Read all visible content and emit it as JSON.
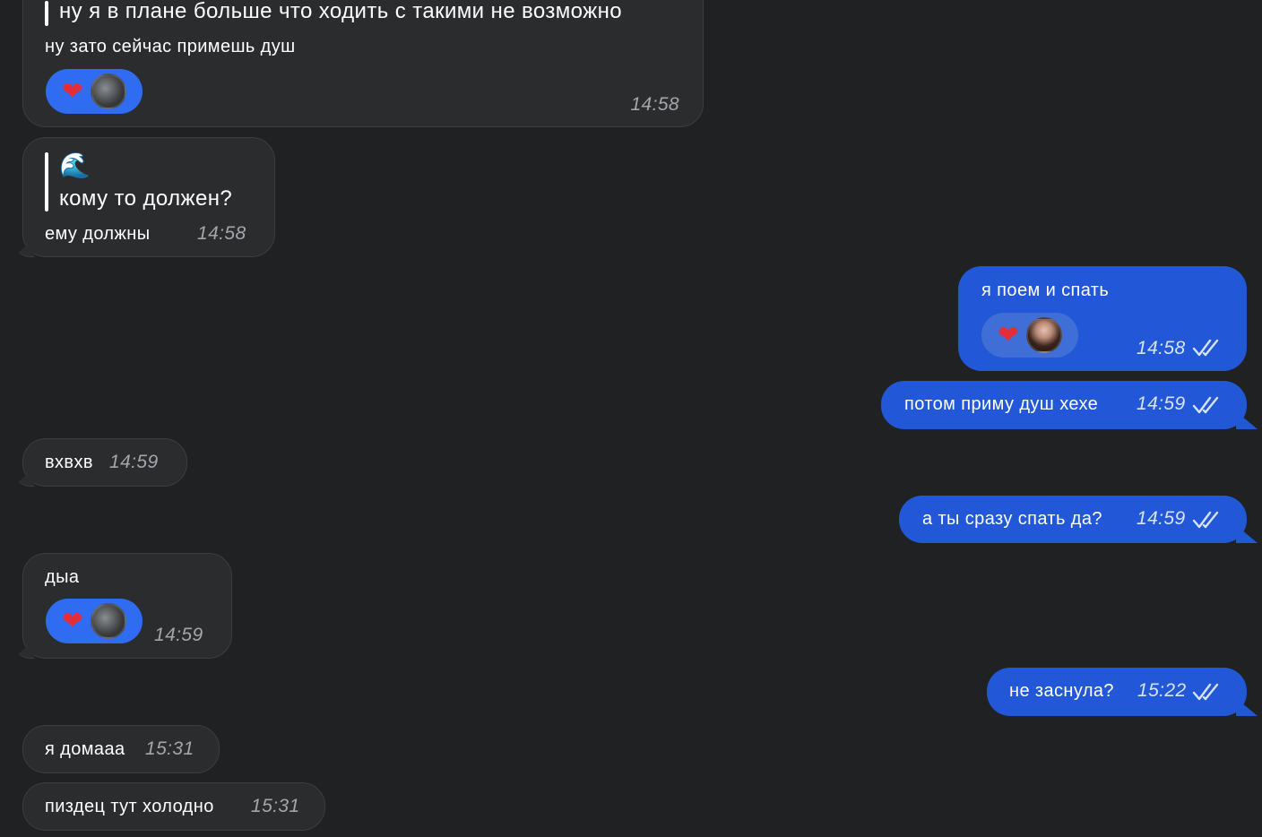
{
  "messages": [
    {
      "id": "m1",
      "quote": "ну я в плане больше что ходить с такими не возможно",
      "text": "ну зато сейчас примешь душ",
      "reaction": "heart",
      "time": "14:58"
    },
    {
      "id": "m2",
      "quote_emoji": "🌊",
      "quote": "кому то должен?",
      "text": "ему должны",
      "time": "14:58"
    },
    {
      "id": "m3",
      "text": "я поем и спать",
      "reaction": "heart",
      "time": "14:58"
    },
    {
      "id": "m4",
      "text": "потом приму душ хехе",
      "time": "14:59"
    },
    {
      "id": "m5",
      "text": "вхвхв",
      "time": "14:59"
    },
    {
      "id": "m6",
      "text": "а ты сразу спать да?",
      "time": "14:59"
    },
    {
      "id": "m7",
      "text": "дыа",
      "reaction": "heart",
      "time": "14:59"
    },
    {
      "id": "m8",
      "text": "не заснула?",
      "time": "15:22"
    },
    {
      "id": "m9",
      "text": "я домааа",
      "time": "15:31"
    },
    {
      "id": "m10",
      "text": "пиздец тут холодно",
      "time": "15:31"
    }
  ],
  "icons": {
    "heart": "❤",
    "read_receipt": "double-check-icon",
    "quote_emoji": "water-wave-emoji"
  },
  "colors": {
    "background": "#1f2123",
    "incoming_bubble": "#2b2c2e",
    "outgoing_bubble": "#2258d8",
    "heart": "#e52d3a"
  }
}
